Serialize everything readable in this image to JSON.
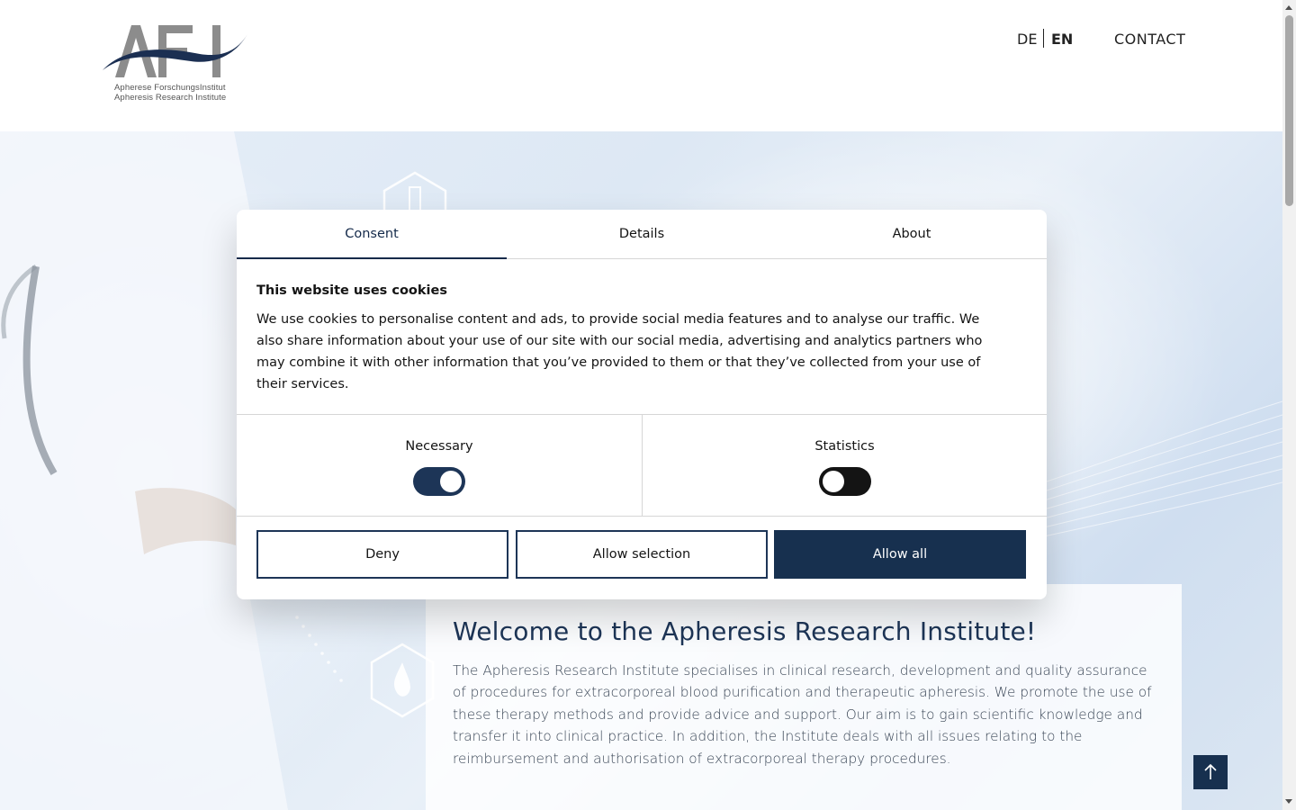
{
  "header": {
    "logo_caption_1": "Apherese ForschungsInstitut",
    "logo_caption_2": "Apheresis Research Institute",
    "lang_de": "DE",
    "lang_en": "EN",
    "contact": "CONTACT"
  },
  "cookie_dialog": {
    "tabs": [
      "Consent",
      "Details",
      "About"
    ],
    "active_tab": "Consent",
    "heading": "This website uses cookies",
    "body": "We use cookies to personalise content and ads, to provide social media features and to analyse our traffic. We also share information about your use of our site with our social media, advertising and analytics partners who may combine it with other information that you’ve provided to them or that they’ve collected from your use of their services.",
    "toggles": [
      {
        "label": "Necessary",
        "state": "on"
      },
      {
        "label": "Statistics",
        "state": "off"
      }
    ],
    "buttons": {
      "deny": "Deny",
      "allow_selection": "Allow selection",
      "allow_all": "Allow all"
    }
  },
  "welcome": {
    "title": "Welcome to the Apheresis Research Institute!",
    "text": "The Apheresis Research Institute specialises in clinical research, development and quality assurance of procedures for extracorporeal blood purification and therapeutic apheresis. We promote the use of these therapy methods and provide advice and support. Our aim is to gain scientific knowledge and transfer it into clinical practice. In addition, the Institute deals with all issues relating to the reimbursement and authorisation of extracorporeal therapy procedures."
  },
  "colors": {
    "brand_navy": "#17304f",
    "logo_grey": "#8a8a8a",
    "toggle_on": "#1d3557",
    "toggle_off": "#141414"
  },
  "icons": {
    "back_to_top": "arrow-up-icon"
  }
}
